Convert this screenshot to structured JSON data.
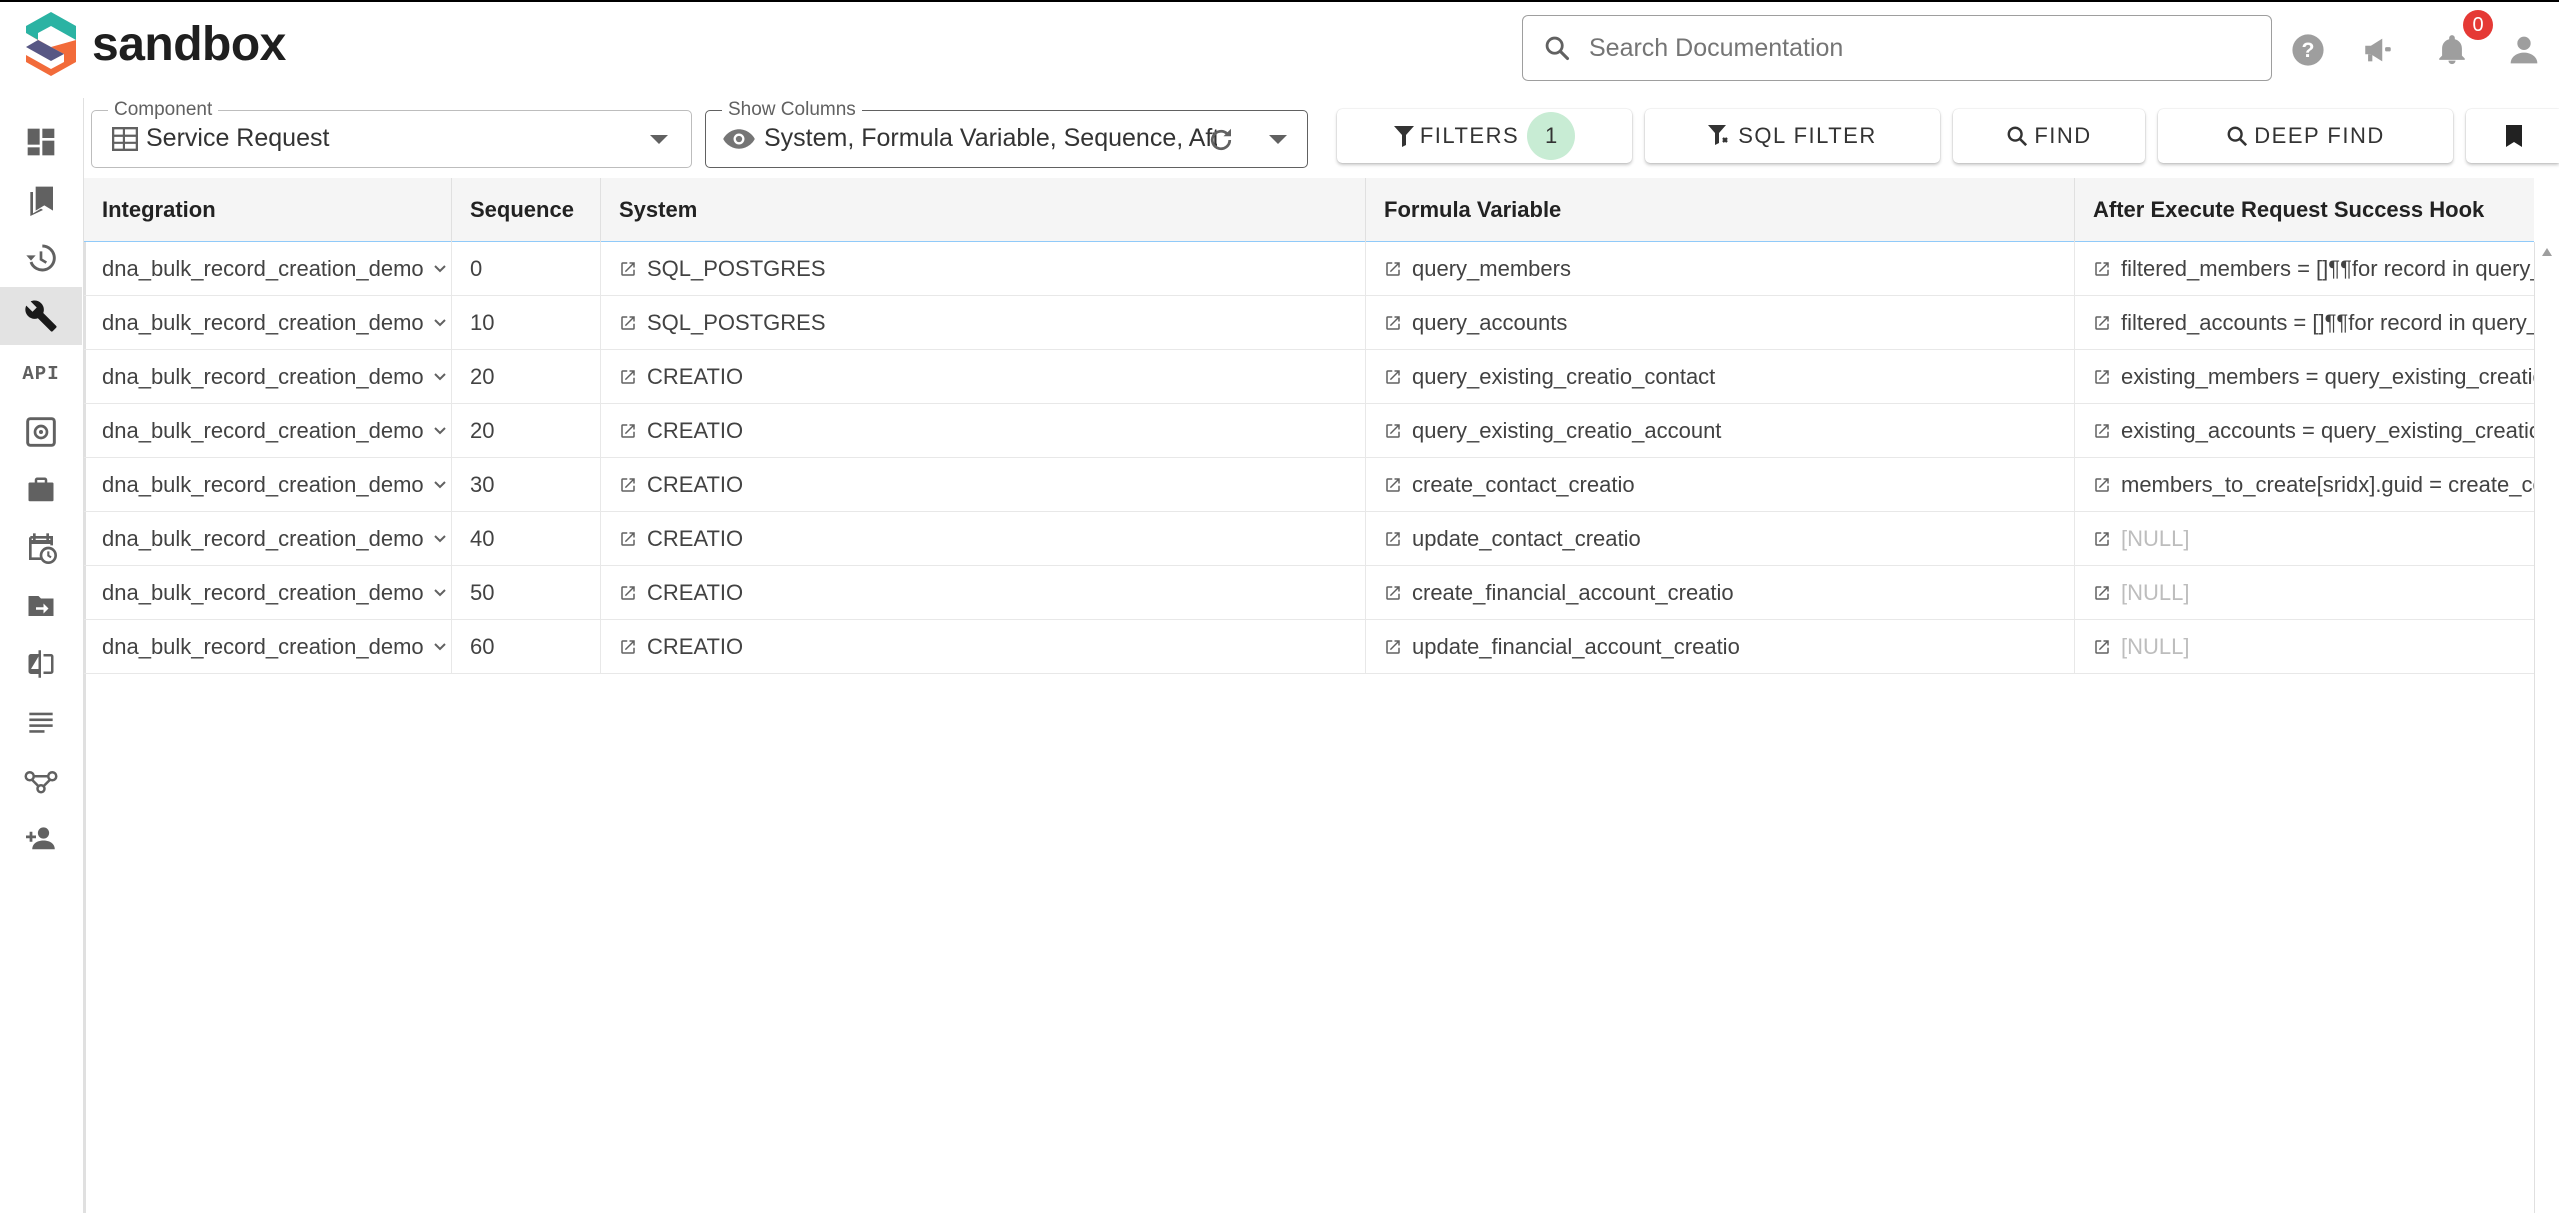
{
  "app": {
    "name": "sandbox"
  },
  "search": {
    "placeholder": "Search Documentation",
    "value": ""
  },
  "header": {
    "notification_count": "0"
  },
  "sidebar": {
    "items": [
      {
        "icon": "dashboard-icon"
      },
      {
        "icon": "bookmarks-icon"
      },
      {
        "icon": "history-icon"
      },
      {
        "icon": "wrench-icon",
        "active": true
      },
      {
        "icon": "api-icon",
        "text": "API"
      },
      {
        "icon": "safe-icon"
      },
      {
        "icon": "briefcase-icon"
      },
      {
        "icon": "calendar-clock-icon"
      },
      {
        "icon": "folder-move-icon"
      },
      {
        "icon": "compare-icon"
      },
      {
        "icon": "list-icon"
      },
      {
        "icon": "flow-icon"
      },
      {
        "icon": "person-add-icon"
      }
    ]
  },
  "toolbar": {
    "component": {
      "label": "Component",
      "value": "Service Request"
    },
    "show_columns": {
      "label": "Show Columns",
      "value": "System, Formula Variable, Sequence, After Execute Request Success Hook"
    },
    "filters_label": "FILTERS",
    "filters_count": "1",
    "sql_filter_label": "SQL FILTER",
    "find_label": "FIND",
    "deep_find_label": "DEEP FIND"
  },
  "table": {
    "columns": [
      "Integration",
      "Sequence",
      "System",
      "Formula Variable",
      "After Execute Request Success Hook"
    ],
    "rows": [
      {
        "integration": "dna_bulk_record_creation_demo",
        "sequence": "0",
        "system": "SQL_POSTGRES",
        "formula_variable": "query_members",
        "hook": "filtered_members = []¶¶for record in query_members"
      },
      {
        "integration": "dna_bulk_record_creation_demo",
        "sequence": "10",
        "system": "SQL_POSTGRES",
        "formula_variable": "query_accounts",
        "hook": "filtered_accounts = []¶¶for record in query_accounts"
      },
      {
        "integration": "dna_bulk_record_creation_demo",
        "sequence": "20",
        "system": "CREATIO",
        "formula_variable": "query_existing_creatio_contact",
        "hook": "existing_members = query_existing_creatio_contact"
      },
      {
        "integration": "dna_bulk_record_creation_demo",
        "sequence": "20",
        "system": "CREATIO",
        "formula_variable": "query_existing_creatio_account",
        "hook": "existing_accounts = query_existing_creatio_account"
      },
      {
        "integration": "dna_bulk_record_creation_demo",
        "sequence": "30",
        "system": "CREATIO",
        "formula_variable": "create_contact_creatio",
        "hook": "members_to_create[sridx].guid = create_contact_creatio"
      },
      {
        "integration": "dna_bulk_record_creation_demo",
        "sequence": "40",
        "system": "CREATIO",
        "formula_variable": "update_contact_creatio",
        "hook": "[NULL]",
        "hook_null": true
      },
      {
        "integration": "dna_bulk_record_creation_demo",
        "sequence": "50",
        "system": "CREATIO",
        "formula_variable": "create_financial_account_creatio",
        "hook": "[NULL]",
        "hook_null": true
      },
      {
        "integration": "dna_bulk_record_creation_demo",
        "sequence": "60",
        "system": "CREATIO",
        "formula_variable": "update_financial_account_creatio",
        "hook": "[NULL]",
        "hook_null": true
      }
    ]
  },
  "colors": {
    "accent_blue": "#90caf9",
    "badge_red": "#e53935",
    "filter_count_bg": "#c8ecd4",
    "logo_teal": "#2bb3a3",
    "logo_orange": "#f26b3a"
  }
}
